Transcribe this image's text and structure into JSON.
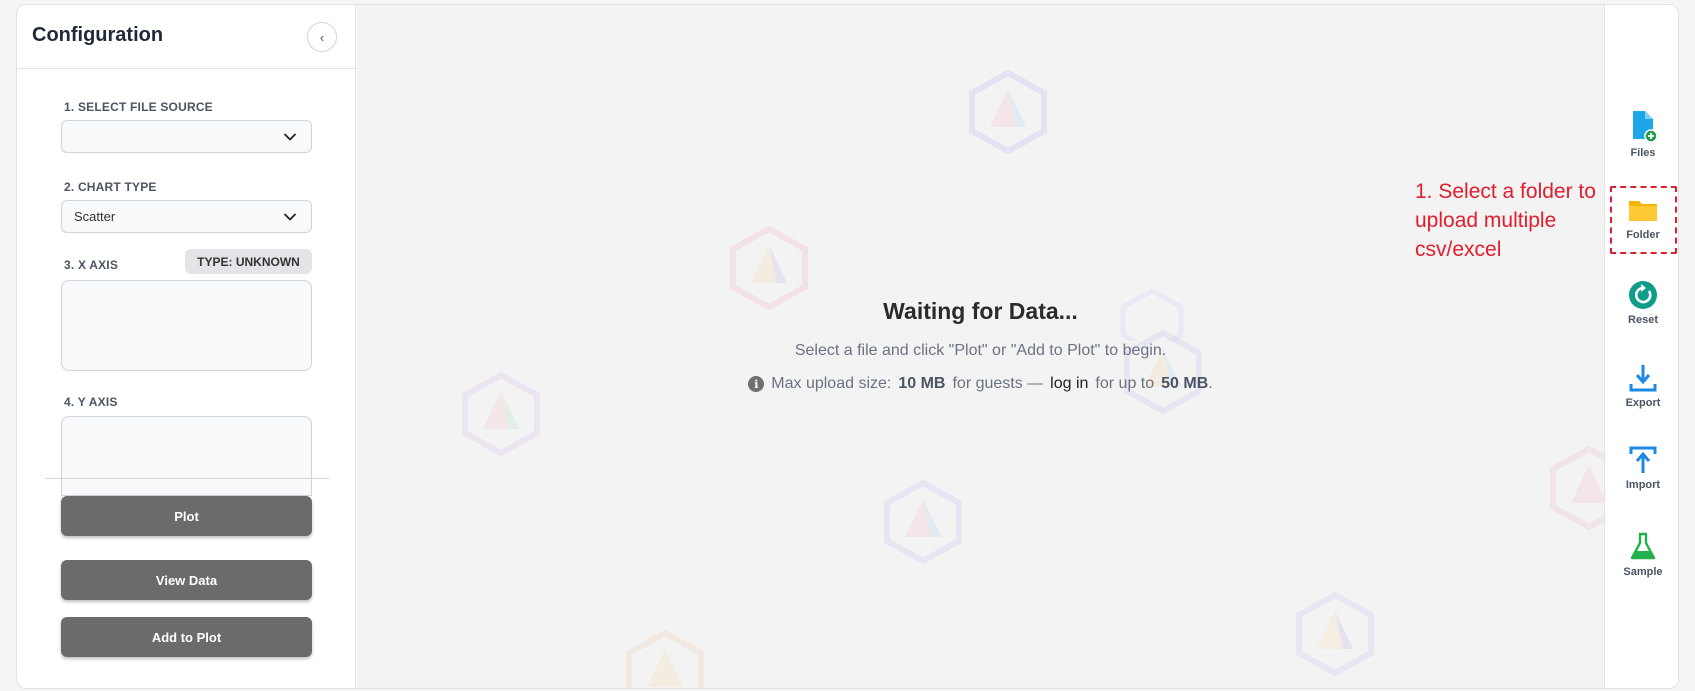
{
  "config": {
    "title": "Configuration",
    "collapse_icon": "chevron-left-icon",
    "file_source": {
      "label": "1. SELECT FILE SOURCE",
      "value": ""
    },
    "chart_type": {
      "label": "2. CHART TYPE",
      "value": "Scatter"
    },
    "x_axis": {
      "label": "3. X AXIS",
      "type_badge": "TYPE: UNKNOWN"
    },
    "y_axis": {
      "label": "4. Y AXIS"
    },
    "buttons": {
      "plot": "Plot",
      "view_data": "View Data",
      "add_to_plot": "Add to Plot"
    }
  },
  "canvas": {
    "title": "Waiting for Data...",
    "subtitle": "Select a file and click \"Plot\" or \"Add to Plot\" to begin.",
    "upload_note": {
      "prefix": "Max upload size:",
      "guest_size": "10 MB",
      "mid": "for guests —",
      "login": "log in",
      "suffix": "for up to",
      "user_size": "50 MB",
      "end": "."
    },
    "annotation": "1. Select a folder to upload multiple csv/excel"
  },
  "rail": {
    "items": [
      {
        "label": "Files",
        "icon": "file-add-icon",
        "color": "#1ea7e8"
      },
      {
        "label": "Folder",
        "icon": "folder-icon",
        "color": "#f5b400"
      },
      {
        "label": "Reset",
        "icon": "reset-icon",
        "color": "#0f9d8a"
      },
      {
        "label": "Export",
        "icon": "export-icon",
        "color": "#1e88e5"
      },
      {
        "label": "Import",
        "icon": "import-icon",
        "color": "#1e88e5"
      },
      {
        "label": "Sample",
        "icon": "flask-icon",
        "color": "#22b14c"
      }
    ]
  },
  "colors": {
    "accent_red": "#e11d2e",
    "button_gray": "#6b6b6b"
  }
}
